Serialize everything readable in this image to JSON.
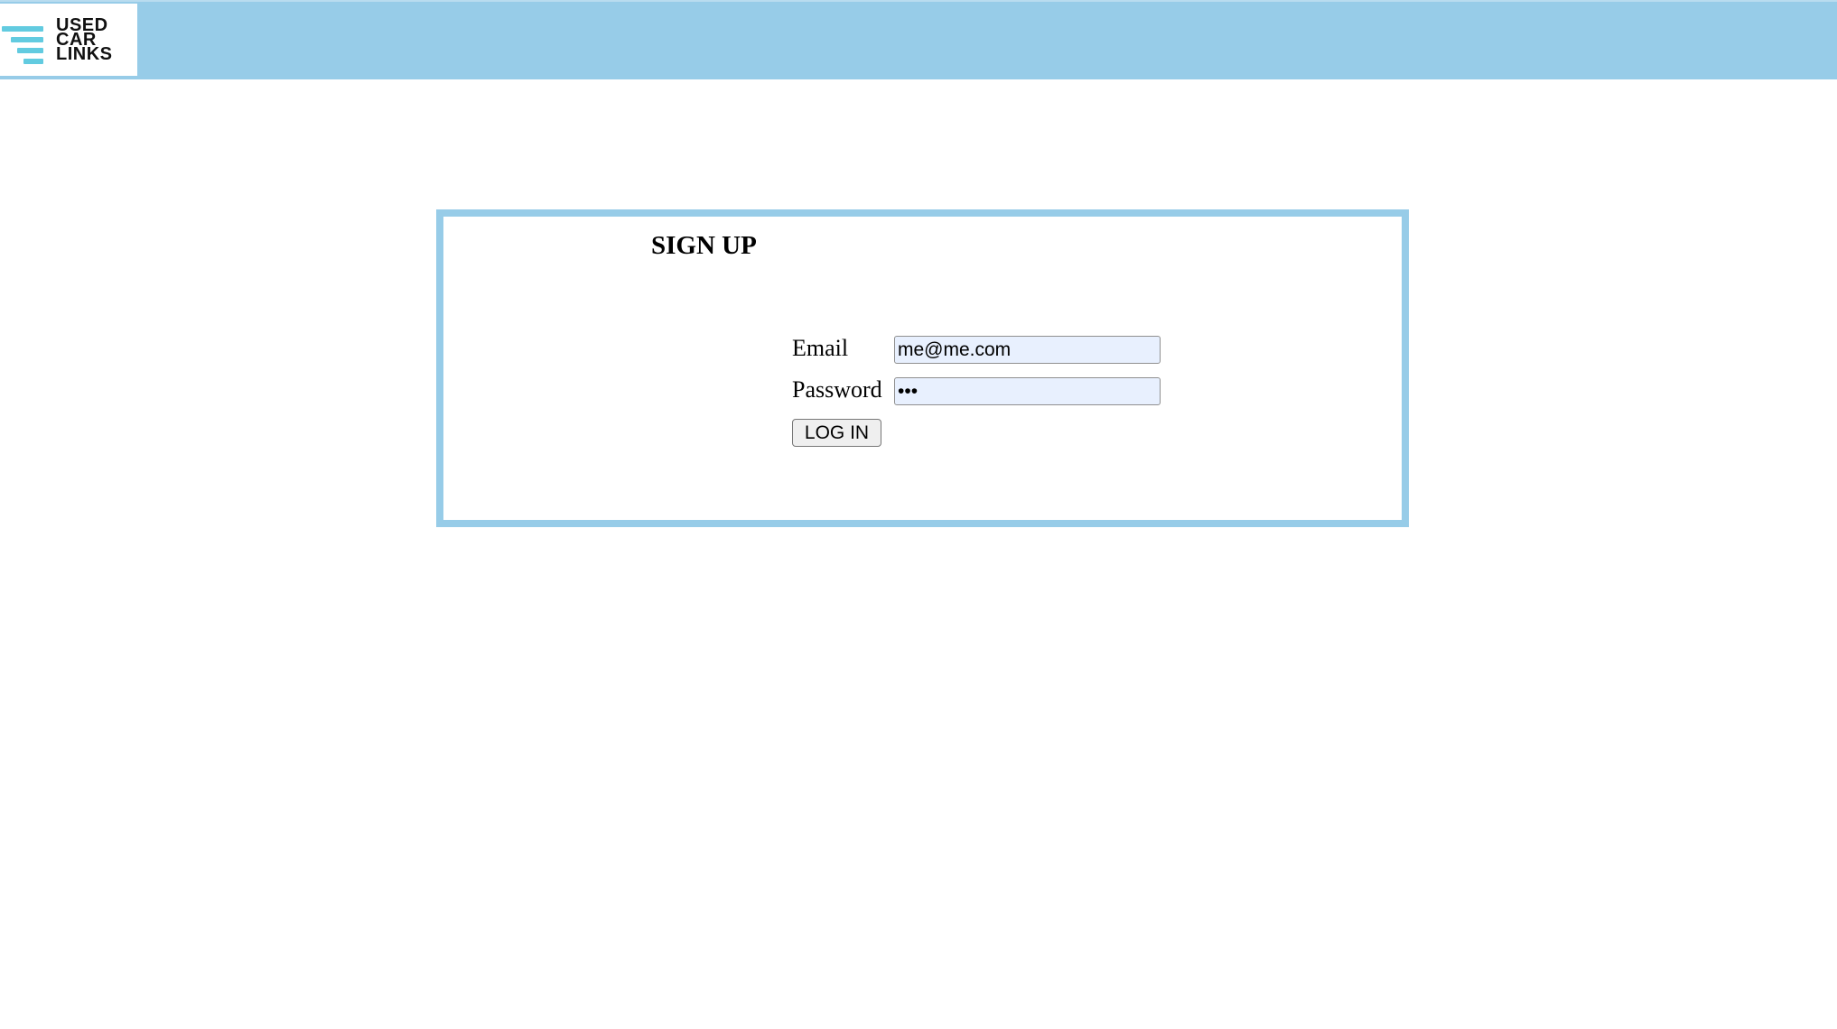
{
  "logo": {
    "line1": "USED",
    "line2": "CAR",
    "line3": "LINKS",
    "icon": "stacked-lines-logo-icon"
  },
  "colors": {
    "header": "#97cce8",
    "accent": "#62cbe0",
    "form_border": "#97cce8",
    "field_fill": "#e8f0fe"
  },
  "form": {
    "title": "SIGN UP",
    "email_label": "Email",
    "email_value": "me@me.com",
    "password_label": "Password",
    "password_value": "•••",
    "submit_label": "LOG IN"
  }
}
